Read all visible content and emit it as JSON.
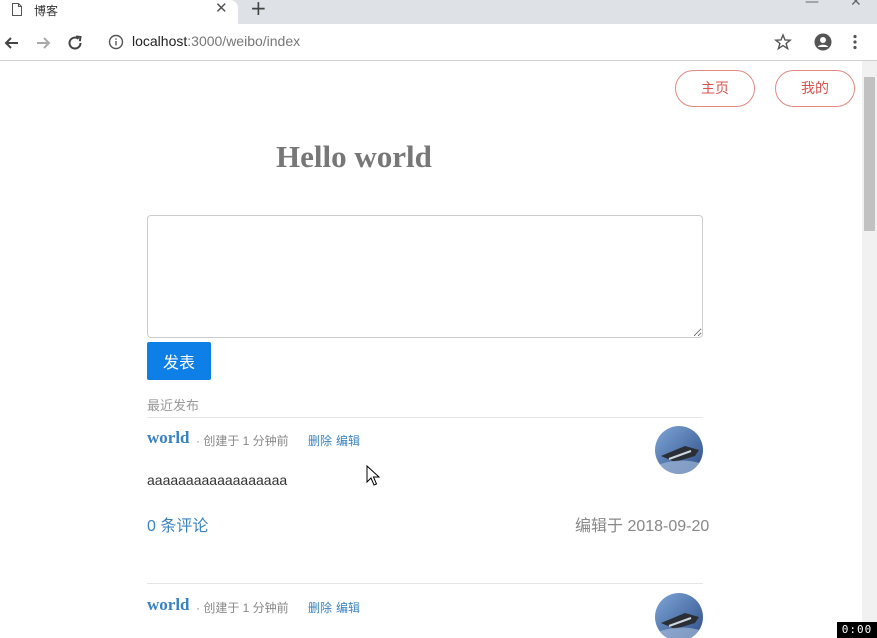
{
  "browser": {
    "tab_title": "博客",
    "url_host": "localhost",
    "url_path": ":3000/weibo/index"
  },
  "nav": {
    "home_label": "主页",
    "mine_label": "我的"
  },
  "header": {
    "title": "Hello world"
  },
  "composer": {
    "value": "",
    "submit_label": "发表"
  },
  "feed": {
    "section_label": "最近发布",
    "posts": [
      {
        "author": "world",
        "meta": "· 创建于 1 分钟前",
        "delete_label": "删除",
        "edit_label": "编辑",
        "content": "aaaaaaaaaaaaaaaaaa",
        "comments": "0 条评论",
        "edited": "编辑于 2018-09-20"
      },
      {
        "author": "world",
        "meta": "· 创建于 1 分钟前",
        "delete_label": "删除",
        "edit_label": "编辑"
      }
    ]
  },
  "overlay": {
    "timer": "0:00"
  },
  "colors": {
    "accent": "#3a83c0",
    "primary_button": "#0f7fe8",
    "pill_border": "#e08a80",
    "pill_text": "#d9534f"
  },
  "icons": [
    "page-icon",
    "close-icon",
    "plus-icon",
    "back-icon",
    "forward-icon",
    "reload-icon",
    "info-icon",
    "star-icon",
    "account-icon",
    "menu-icon",
    "cursor-icon"
  ]
}
